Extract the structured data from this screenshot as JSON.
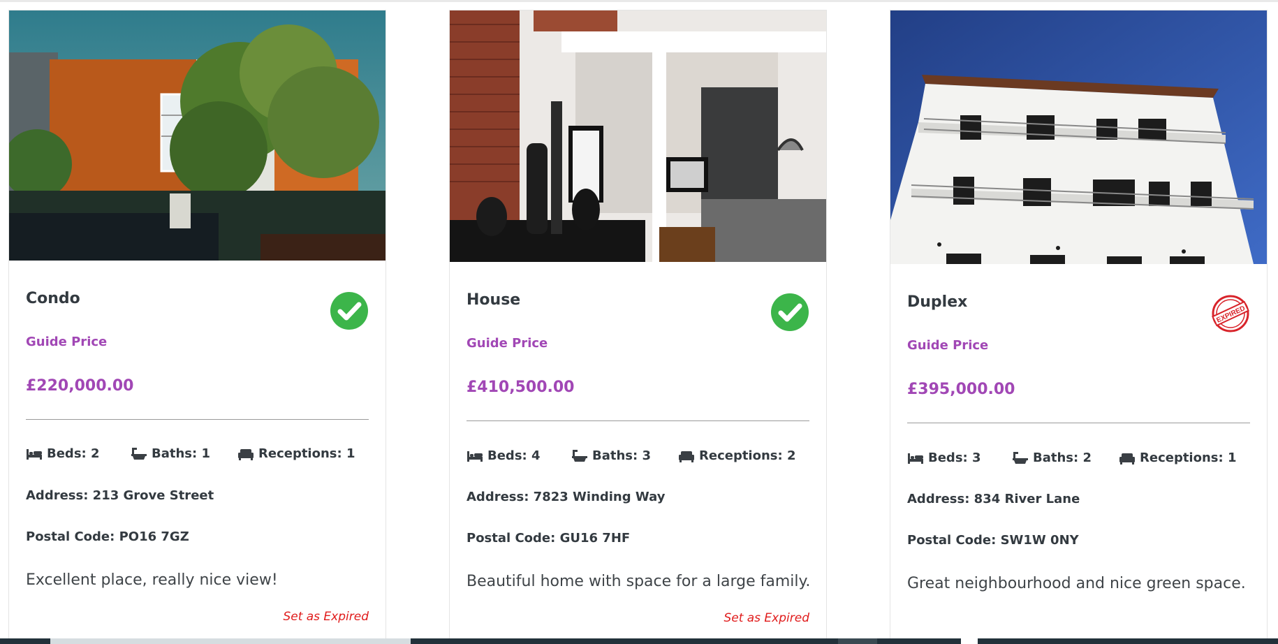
{
  "listings": [
    {
      "type": "Condo",
      "status": "active",
      "status_icon": "check-circle-icon",
      "guide_label": "Guide Price",
      "price": "£220,000.00",
      "beds": "Beds: 2",
      "baths": "Baths: 1",
      "receptions": "Receptions: 1",
      "address": "Address: 213 Grove Street",
      "postal_code": "Postal Code: PO16 7GZ",
      "description": "Excellent place, really nice view!",
      "action": "Set as Expired"
    },
    {
      "type": "House",
      "status": "active",
      "status_icon": "check-circle-icon",
      "guide_label": "Guide Price",
      "price": "£410,500.00",
      "beds": "Beds: 4",
      "baths": "Baths: 3",
      "receptions": "Receptions: 2",
      "address": "Address: 7823 Winding Way",
      "postal_code": "Postal Code: GU16 7HF",
      "description": "Beautiful home with space for a large family.",
      "action": "Set as Expired"
    },
    {
      "type": "Duplex",
      "status": "expired",
      "status_icon": "expired-stamp-icon",
      "stamp_text": "EXPIRED",
      "guide_label": "Guide Price",
      "price": "£395,000.00",
      "beds": "Beds: 3",
      "baths": "Baths: 2",
      "receptions": "Receptions: 1",
      "address": "Address: 834 River Lane",
      "postal_code": "Postal Code: SW1W 0NY",
      "description": "Great neighbourhood and nice green space."
    }
  ],
  "colors": {
    "accent": "#a147b5",
    "active_green": "#3cb54a",
    "expired_red": "#d8232a",
    "action_red": "#e01b1b"
  }
}
